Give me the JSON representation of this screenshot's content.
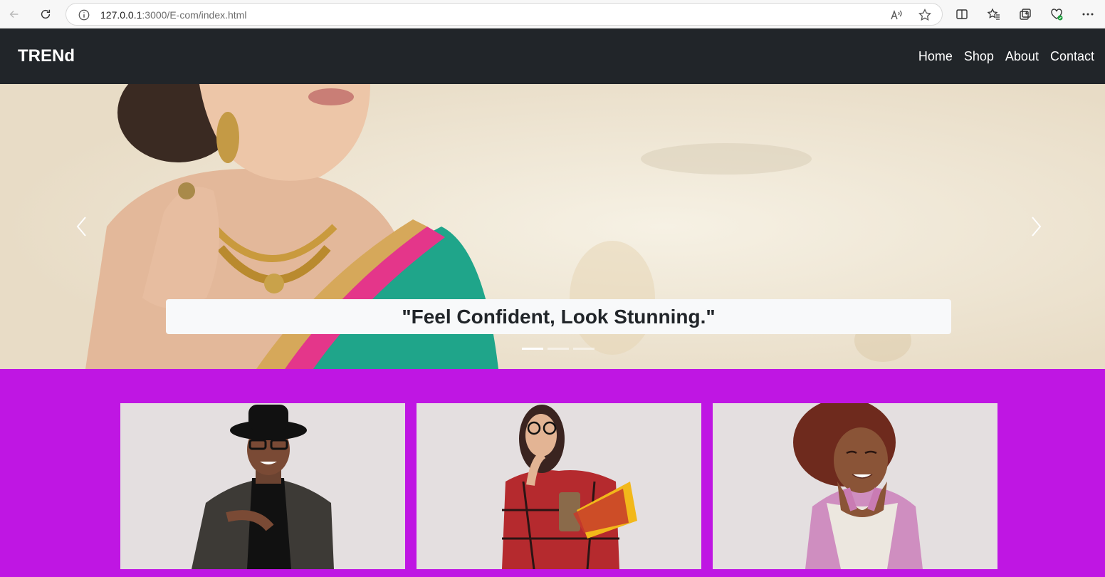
{
  "browser": {
    "url_host": "127.0.0.1",
    "url_path": ":3000/E-com/index.html"
  },
  "navbar": {
    "brand": "TRENd",
    "links": [
      "Home",
      "Shop",
      "About",
      "Contact"
    ]
  },
  "hero": {
    "caption": "\"Feel Confident, Look Stunning.\"",
    "slide_count": 3,
    "active_slide": 1
  },
  "products": {
    "cards": [
      {
        "image": "man-in-hat-and-plaid-blazer"
      },
      {
        "image": "woman-with-glasses-holding-folders"
      },
      {
        "image": "woman-with-curly-hair-smiling"
      }
    ]
  },
  "colors": {
    "navbar_bg": "#212529",
    "products_bg": "#bf16e3",
    "card_bg": "#e4dfe0"
  }
}
